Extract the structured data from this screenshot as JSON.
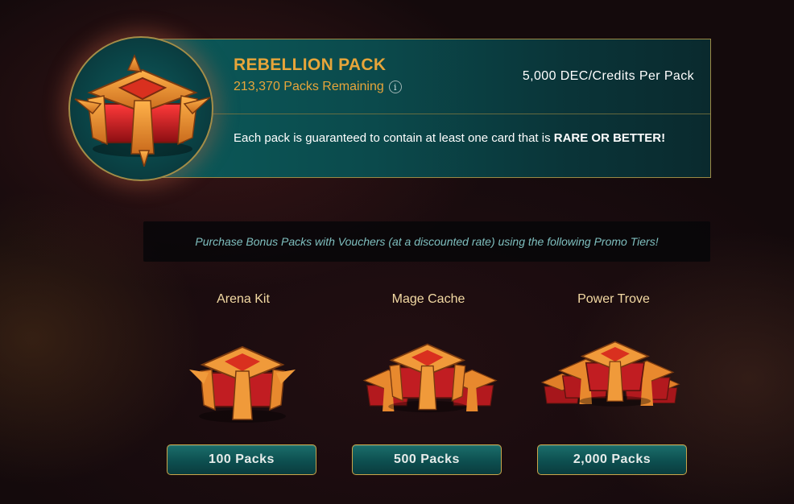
{
  "pack": {
    "title": "REBELLION PACK",
    "remaining": "213,370 Packs Remaining",
    "price": "5,000 DEC/Credits Per Pack",
    "description_prefix": "Each pack is guaranteed to contain at least one card that is ",
    "description_emphasis": "RARE OR BETTER!",
    "info_icon_glyph": "i"
  },
  "promo": {
    "text": "Purchase Bonus Packs with Vouchers (at a discounted rate) using the following Promo Tiers!"
  },
  "tiers": [
    {
      "name": "Arena Kit",
      "button_label": "100 Packs",
      "chest_count": 1
    },
    {
      "name": "Mage Cache",
      "button_label": "500 Packs",
      "chest_count": 3
    },
    {
      "name": "Power Trove",
      "button_label": "2,000 Packs",
      "chest_count": 5
    }
  ],
  "colors": {
    "accent_gold": "#e7a53a",
    "banner_teal": "#0b5a5a",
    "button_border": "#c9a54a",
    "promo_text": "#7fbfbf"
  },
  "icons": {
    "pack_chest": "red-gold-chest-icon",
    "info": "info-icon"
  }
}
